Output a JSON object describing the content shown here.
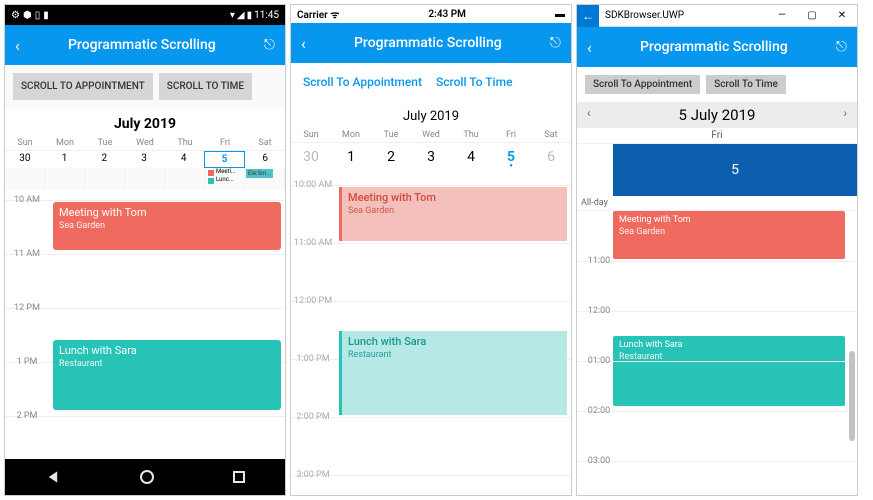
{
  "app_title": "Programmatic Scrolling",
  "buttons": {
    "scroll_appt": "Scroll To Appointment",
    "scroll_time": "Scroll To Time"
  },
  "android": {
    "status_time": "11:45",
    "btn_appt": "SCROLL TO APPOINTMENT",
    "btn_time": "SCROLL TO TIME",
    "month": "July 2019",
    "days": [
      "Sun",
      "Mon",
      "Tue",
      "Wed",
      "Thu",
      "Fri",
      "Sat"
    ],
    "dates": [
      "30",
      "1",
      "2",
      "3",
      "4",
      "5",
      "6"
    ],
    "mini_label1": "Meeti...",
    "mini_label2": "Lunc...",
    "mini_badge": "Ele:Sm...",
    "times": [
      "10 AM",
      "11 AM",
      "12 PM",
      "1 PM",
      "2 PM"
    ],
    "appts": {
      "meeting": {
        "title": "Meeting with Tom",
        "sub": "Sea Garden"
      },
      "lunch": {
        "title": "Lunch with Sara",
        "sub": "Restaurant"
      }
    }
  },
  "ios": {
    "carrier": "Carrier",
    "status_time": "2:43 PM",
    "month": "July 2019",
    "days": [
      "Sun",
      "Mon",
      "Tue",
      "Wed",
      "Thu",
      "Fri",
      "Sat"
    ],
    "dates": [
      "30",
      "1",
      "2",
      "3",
      "4",
      "5",
      "6"
    ],
    "times": [
      "10:00 AM",
      "11:00 AM",
      "12:00 PM",
      "1:00 PM",
      "2:00 PM",
      "3:00 PM"
    ],
    "appts": {
      "meeting": {
        "title": "Meeting with Tom",
        "sub": "Sea Garden"
      },
      "lunch": {
        "title": "Lunch with Sara",
        "sub": "Restaurant"
      }
    }
  },
  "uwp": {
    "window_title": "SDKBrowser.UWP",
    "month": "5 July 2019",
    "day_label": "Fri",
    "date_num": "5",
    "allday": "All-day",
    "times": [
      "11:00",
      "12:00",
      "01:00",
      "02:00",
      "03:00"
    ],
    "appts": {
      "meeting": {
        "title": "Meeting with Tom",
        "sub": "Sea Garden"
      },
      "lunch": {
        "title": "Lunch with Sara",
        "sub": "Restaurant"
      }
    }
  }
}
